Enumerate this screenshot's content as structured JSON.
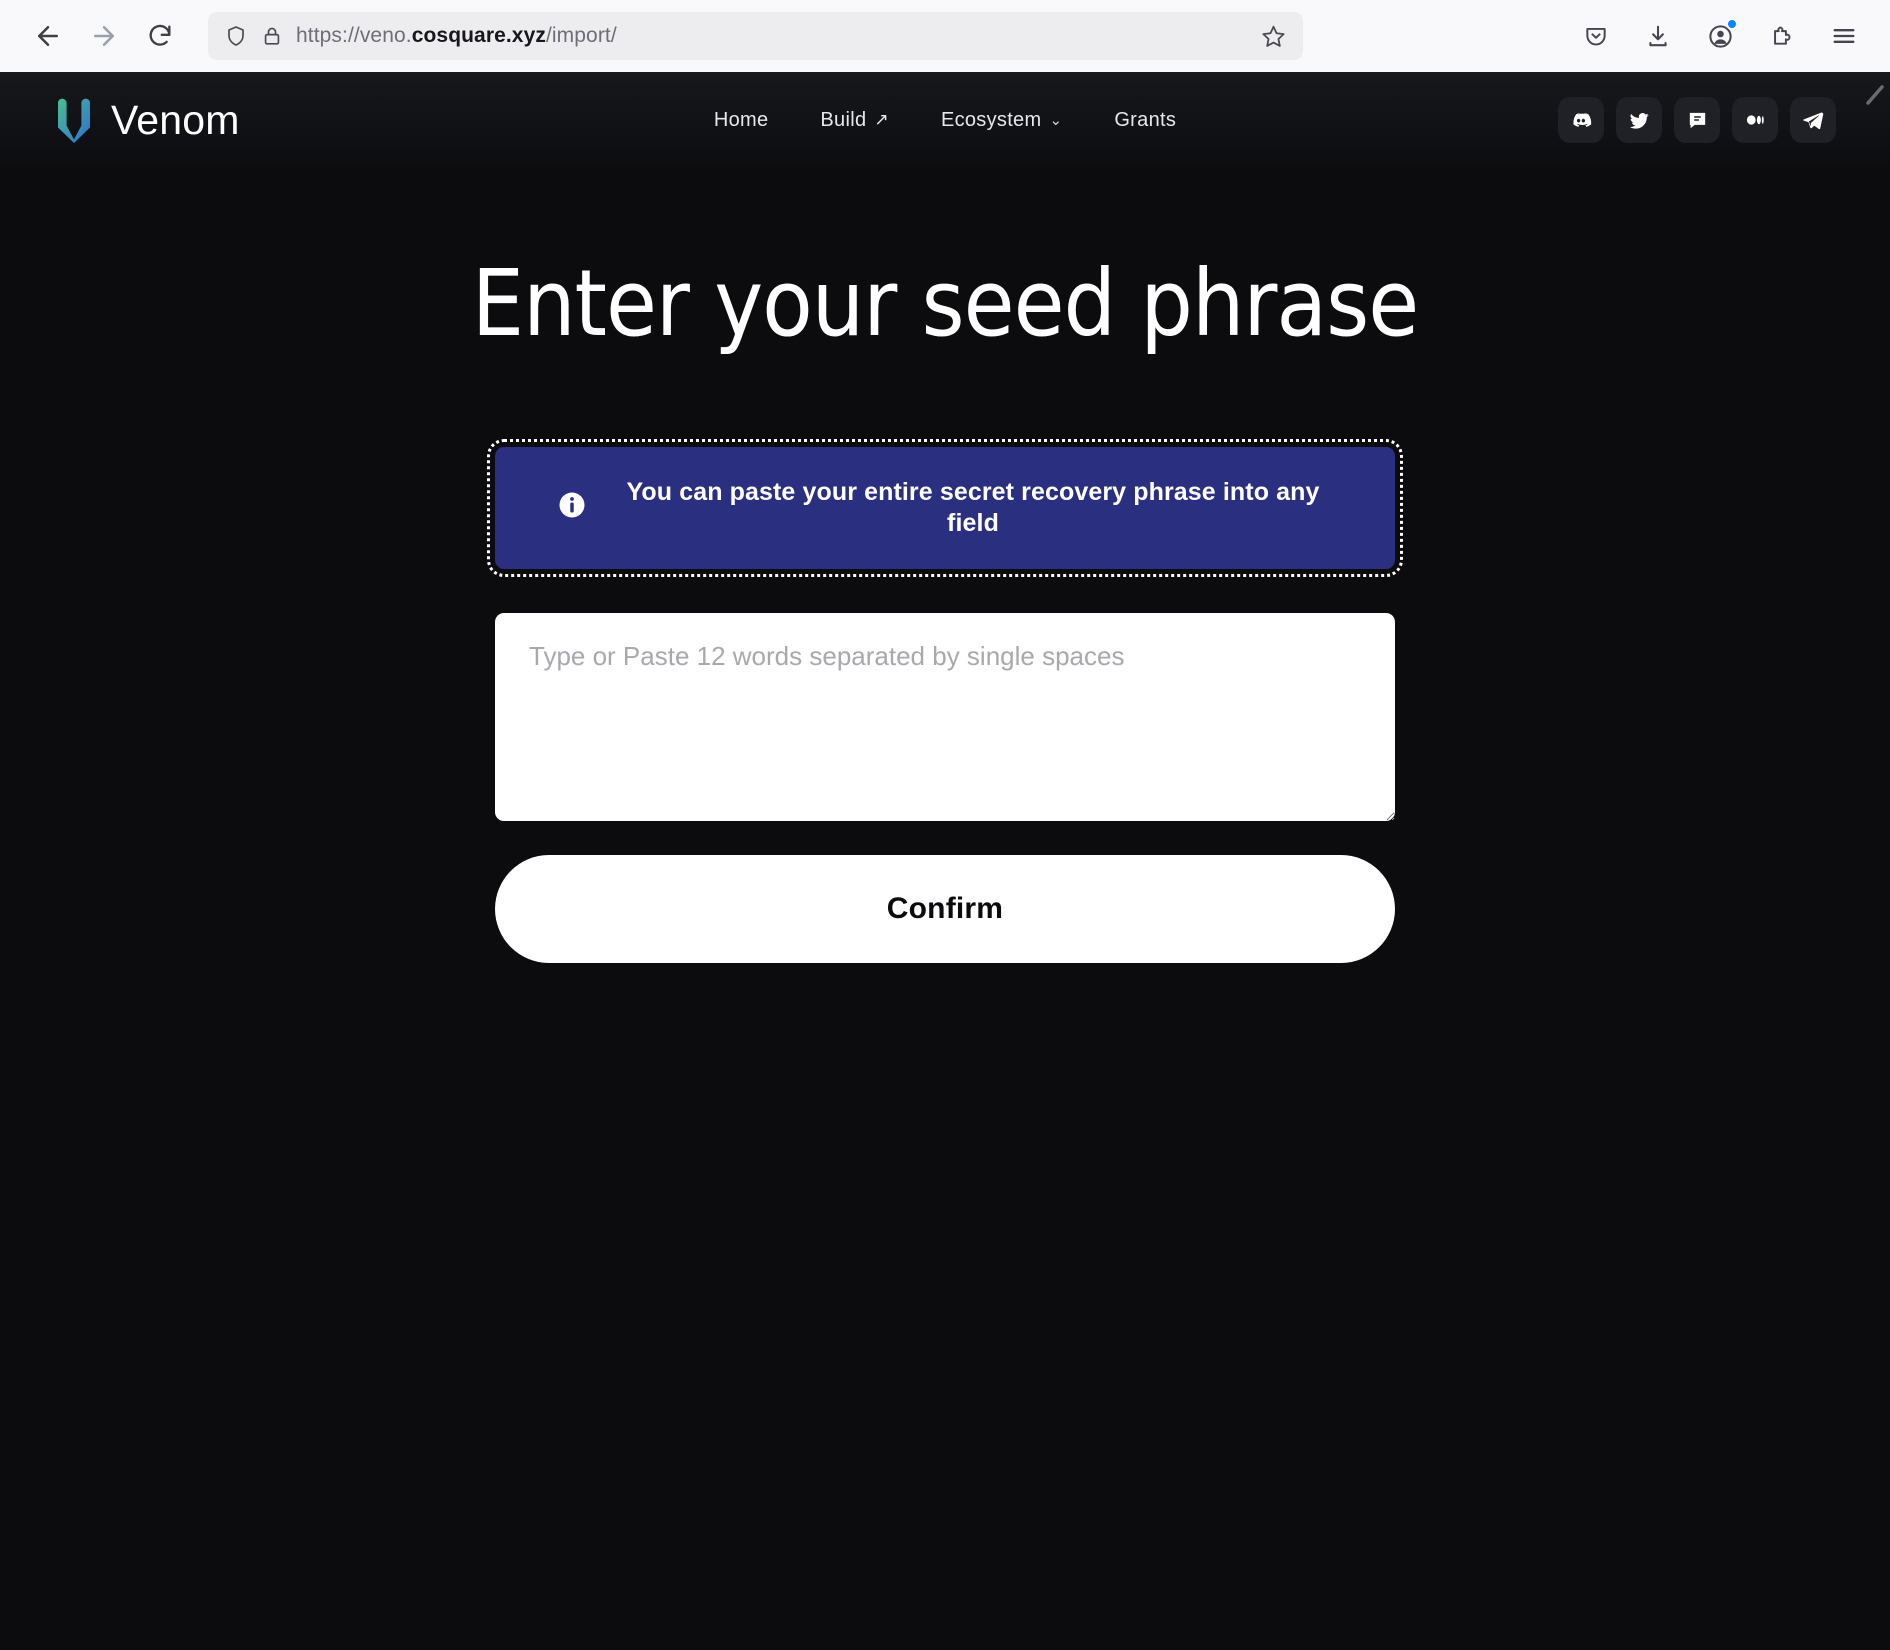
{
  "browser": {
    "back_label": "Back",
    "forward_label": "Forward",
    "reload_label": "Reload",
    "url_scheme": "https://veno.",
    "url_host": "cosquare.xyz",
    "url_path": "/import/",
    "url_full": "https://veno.cosquare.xyz/import/",
    "bookmark_label": "Bookmark this page",
    "toolbar_icons": [
      {
        "name": "pocket-icon",
        "label": "Save to Pocket"
      },
      {
        "name": "download-icon",
        "label": "Downloads"
      },
      {
        "name": "account-icon",
        "label": "Account"
      },
      {
        "name": "extensions-icon",
        "label": "Extensions"
      },
      {
        "name": "menu-icon",
        "label": "Open application menu"
      }
    ]
  },
  "site_header": {
    "brand_name": "Venom",
    "brand_logo_name": "venom-v-logo",
    "nav": [
      {
        "label": "Home",
        "suffix": "",
        "icon": ""
      },
      {
        "label": "Build",
        "suffix": "↗",
        "icon": "external-link-icon"
      },
      {
        "label": "Ecosystem",
        "suffix": "⌄",
        "icon": "chevron-down-icon"
      },
      {
        "label": "Grants",
        "suffix": "",
        "icon": ""
      }
    ],
    "socials": [
      {
        "name": "discord-icon",
        "label": "Discord"
      },
      {
        "name": "twitter-icon",
        "label": "Twitter"
      },
      {
        "name": "chat-bubble-icon",
        "label": "Chat"
      },
      {
        "name": "medium-icon",
        "label": "Medium"
      },
      {
        "name": "telegram-icon",
        "label": "Telegram"
      }
    ]
  },
  "main": {
    "title": "Enter your seed phrase",
    "info_banner": {
      "icon": "info-icon",
      "text": "You can paste your entire secret recovery phrase into any field"
    },
    "seed_input": {
      "placeholder": "Type or Paste 12 words separated by single spaces",
      "value": ""
    },
    "confirm_label": "Confirm"
  },
  "colors": {
    "page_background": "#0c0c0e",
    "header_background": "#111216",
    "banner_background": "#2a2f80",
    "button_background": "#ffffff",
    "accent_badge": "#0a84ff",
    "logo_gradient_start": "#4bbf8f",
    "logo_gradient_end": "#2d6ed4"
  }
}
